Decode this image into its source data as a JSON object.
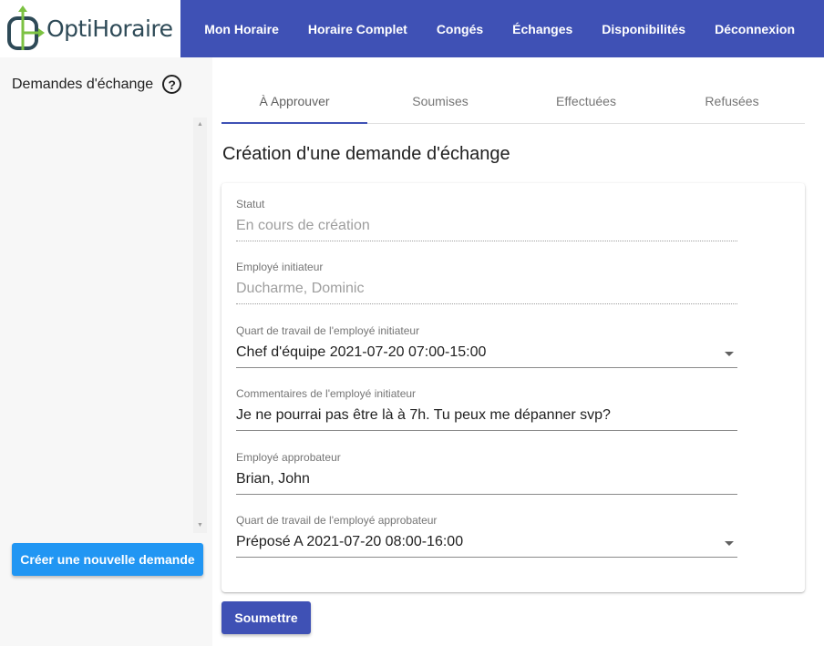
{
  "app": {
    "logo_text": "OptiHoraire"
  },
  "nav": {
    "items": [
      {
        "label": "Mon Horaire"
      },
      {
        "label": "Horaire Complet"
      },
      {
        "label": "Congés"
      },
      {
        "label": "Échanges"
      },
      {
        "label": "Disponibilités"
      },
      {
        "label": "Déconnexion"
      }
    ]
  },
  "sidebar": {
    "title": "Demandes d'échange",
    "help_icon": "?",
    "create_button": "Créer une nouvelle demande"
  },
  "tabs": [
    {
      "label": "À Approuver",
      "active": true
    },
    {
      "label": "Soumises"
    },
    {
      "label": "Effectuées"
    },
    {
      "label": "Refusées"
    }
  ],
  "form": {
    "title": "Création d'une demande d'échange",
    "fields": {
      "statut": {
        "label": "Statut",
        "value": "En cours de création"
      },
      "initiateur": {
        "label": "Employé initiateur",
        "value": "Ducharme, Dominic"
      },
      "quart_initiateur": {
        "label": "Quart de travail de l'employé initiateur",
        "value": "Chef d'équipe 2021-07-20 07:00-15:00"
      },
      "commentaires": {
        "label": "Commentaires de l'employé initiateur",
        "value": "Je ne pourrai pas être là à 7h. Tu peux me dépanner svp?"
      },
      "approbateur": {
        "label": "Employé approbateur",
        "value": "Brian, John"
      },
      "quart_approbateur": {
        "label": "Quart de travail de l'employé approbateur",
        "value": "Préposé A 2021-07-20 08:00-16:00"
      }
    },
    "submit_button": "Soumettre"
  },
  "colors": {
    "primary": "#3f51b5",
    "accent": "#2196f3",
    "logo_green": "#7cc242",
    "logo_dark": "#2e4a57"
  },
  "icons": [
    "logo-icon",
    "help-icon",
    "scroll-up-icon",
    "scroll-down-icon",
    "dropdown-arrow-icon"
  ]
}
